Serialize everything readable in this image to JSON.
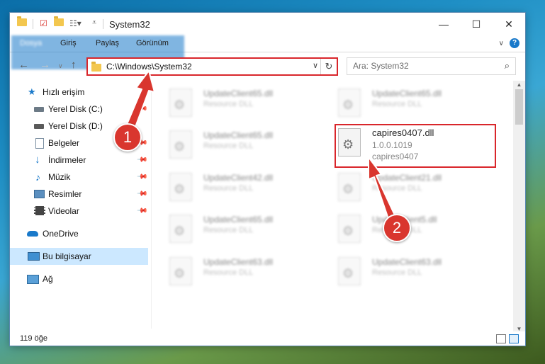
{
  "window": {
    "title": "System32",
    "controls": {
      "minimize": "—",
      "maximize": "☐",
      "close": "✕"
    }
  },
  "ribbon": {
    "tabs": [
      {
        "label": "Dosya"
      },
      {
        "label": "Giriş"
      },
      {
        "label": "Paylaş"
      },
      {
        "label": "Görünüm"
      }
    ],
    "help": "?"
  },
  "address": {
    "path": "C:\\Windows\\System32",
    "search_placeholder": "Ara: System32"
  },
  "sidebar": {
    "items": [
      {
        "label": "Hızlı erişim",
        "icon": "star-icon"
      },
      {
        "label": "Yerel Disk (C:)",
        "icon": "drive-icon"
      },
      {
        "label": "Yerel Disk (D:)",
        "icon": "drive-icon"
      },
      {
        "label": "Belgeler",
        "icon": "documents-icon"
      },
      {
        "label": "İndirmeler",
        "icon": "download-icon"
      },
      {
        "label": "Müzik",
        "icon": "music-icon"
      },
      {
        "label": "Resimler",
        "icon": "pictures-icon"
      },
      {
        "label": "Videolar",
        "icon": "videos-icon"
      },
      {
        "label": "OneDrive",
        "icon": "cloud-icon"
      },
      {
        "label": "Bu bilgisayar",
        "icon": "computer-icon"
      },
      {
        "label": "Ağ",
        "icon": "network-icon"
      }
    ]
  },
  "files": {
    "left": [
      {
        "name": "UpdateClient65.dll",
        "type": "Resource DLL"
      },
      {
        "name": "UpdateClient65.dll",
        "type": "Resource DLL"
      },
      {
        "name": "UpdateClient42.dll",
        "type": "Resource DLL"
      },
      {
        "name": "UpdateClient65.dll",
        "type": "Resource DLL"
      },
      {
        "name": "UpdateClient63.dll",
        "type": "Resource DLL"
      }
    ],
    "right": [
      {
        "name": "UpdateClient65.dll",
        "type": "Resource DLL"
      },
      {
        "name": "capires0407.dll",
        "version": "1.0.0.1019",
        "type": "capires0407"
      },
      {
        "name": "UpdateClient21.dll",
        "type": "Resource DLL"
      },
      {
        "name": "UpdateClient5.dll",
        "type": "Resource DLL"
      },
      {
        "name": "UpdateClient63.dll",
        "type": "Resource DLL"
      }
    ]
  },
  "status": {
    "count": "119 öğe"
  },
  "annotations": {
    "badge1": "1",
    "badge2": "2"
  },
  "colors": {
    "accent": "#1979ca",
    "highlight": "#d9262b",
    "selected": "#cce8ff"
  }
}
